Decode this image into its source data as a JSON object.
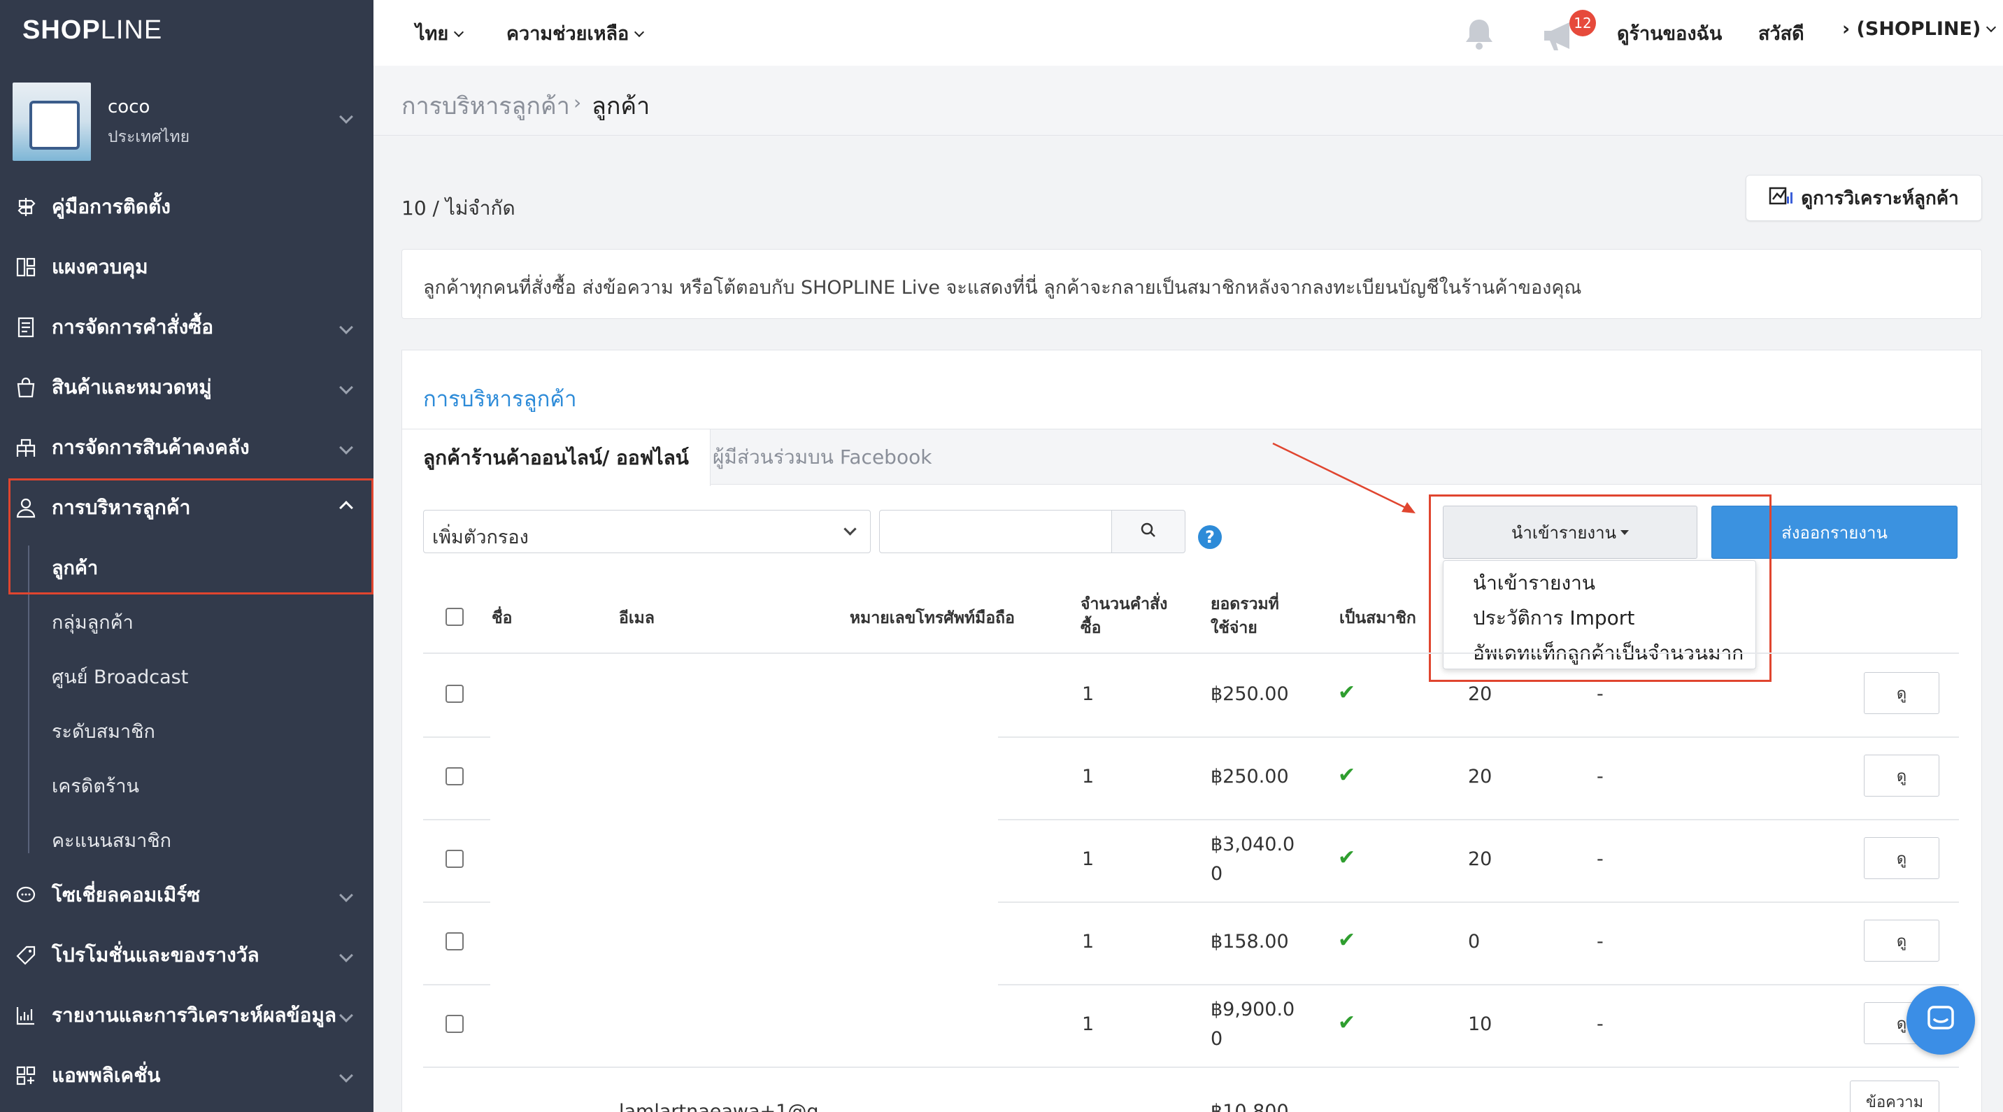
{
  "brand": {
    "logo_bold": "SHOP",
    "logo_light": "LINE"
  },
  "store": {
    "name": "coco",
    "country": "ประเทศไทย"
  },
  "sidebar": {
    "items": [
      {
        "label": "คู่มือการติดตั้ง",
        "icon": "signpost-icon"
      },
      {
        "label": "แผงควบคุม",
        "icon": "dashboard-icon"
      },
      {
        "label": "การจัดการคำสั่งซื้อ",
        "icon": "order-icon"
      },
      {
        "label": "สินค้าและหมวดหมู่",
        "icon": "bag-icon"
      },
      {
        "label": "การจัดการสินค้าคงคลัง",
        "icon": "inventory-icon"
      },
      {
        "label": "การบริหารลูกค้า",
        "icon": "user-icon"
      },
      {
        "label": "โซเชี่ยลคอมเมิร์ซ",
        "icon": "chat-icon"
      },
      {
        "label": "โปรโมชั่นและของรางวัล",
        "icon": "tag-icon"
      },
      {
        "label": "รายงานและการวิเคราะห์ผลข้อมูล",
        "icon": "chart-icon"
      },
      {
        "label": "แอพพลิเคชั่น",
        "icon": "apps-icon"
      }
    ],
    "sub_items": [
      "ลูกค้า",
      "กลุ่มลูกค้า",
      "ศูนย์ Broadcast",
      "ระดับสมาชิก",
      "เครดิตร้าน",
      "คะแนนสมาชิก"
    ]
  },
  "topbar": {
    "language": "ไทย",
    "help": "ความช่วยเหลือ",
    "notification_count": "12",
    "view_store": "ดูร้านของฉัน",
    "greeting": "สวัสดี",
    "account": "› (SHOPLINE)"
  },
  "breadcrumb": {
    "parent": "การบริหารลูกค้า",
    "current": "ลูกค้า"
  },
  "count_text": "10 / ไม่จำกัด",
  "analyze_button": "ดูการวิเคราะห์ลูกค้า",
  "info_text": "ลูกค้าทุกคนที่สั่งซื้อ ส่งข้อความ หรือโต้ตอบกับ SHOPLINE Live จะแสดงที่นี่ ลูกค้าจะกลายเป็นสมาชิกหลังจากลงทะเบียนบัญชีในร้านค้าของคุณ",
  "panel": {
    "title": "การบริหารลูกค้า",
    "tabs": [
      "ลูกค้าร้านค้าออนไลน์/ ออฟไลน์",
      "ผู้มีส่วนร่วมบน Facebook"
    ],
    "filter_placeholder": "เพิ่มตัวกรอง",
    "import_button": "นำเข้ารายงาน",
    "export_button": "ส่งออกรายงาน",
    "import_menu": [
      "นำเข้ารายงาน",
      "ประวัติการ Import",
      "อัพเดทแท็กลูกค้าเป็นจำนวนมาก"
    ]
  },
  "table": {
    "headers": {
      "name": "ชื่อ",
      "email": "อีเมล",
      "phone": "หมายเลขโทรศัพท์มือถือ",
      "orders_1": "จำนวนคำสั่ง",
      "orders_2": "ซื้อ",
      "spent_1": "ยอดรวมที่",
      "spent_2": "ใช้จ่าย",
      "member": "เป็นสมาชิก"
    },
    "rows": [
      {
        "orders": "1",
        "spent": "฿250.00",
        "spent2": "",
        "points": "20",
        "dash": "-",
        "action": "ดู"
      },
      {
        "orders": "1",
        "spent": "฿250.00",
        "spent2": "",
        "points": "20",
        "dash": "-",
        "action": "ดู"
      },
      {
        "orders": "1",
        "spent": "฿3,040.0",
        "spent2": "0",
        "points": "20",
        "dash": "-",
        "action": "ดู"
      },
      {
        "orders": "1",
        "spent": "฿158.00",
        "spent2": "",
        "points": "0",
        "dash": "-",
        "action": "ดู"
      },
      {
        "orders": "1",
        "spent": "฿9,900.0",
        "spent2": "0",
        "points": "10",
        "dash": "-",
        "action": "ดู"
      }
    ],
    "last_row": {
      "email_partial": "lamlartnaeawa+1@g",
      "spent_partial": "฿10,800",
      "action": "ข้อความ"
    }
  },
  "colors": {
    "sidebar": "#323a4b",
    "accent": "#2d8bd8",
    "highlight": "#e0452f",
    "check": "#2f9e2f"
  }
}
